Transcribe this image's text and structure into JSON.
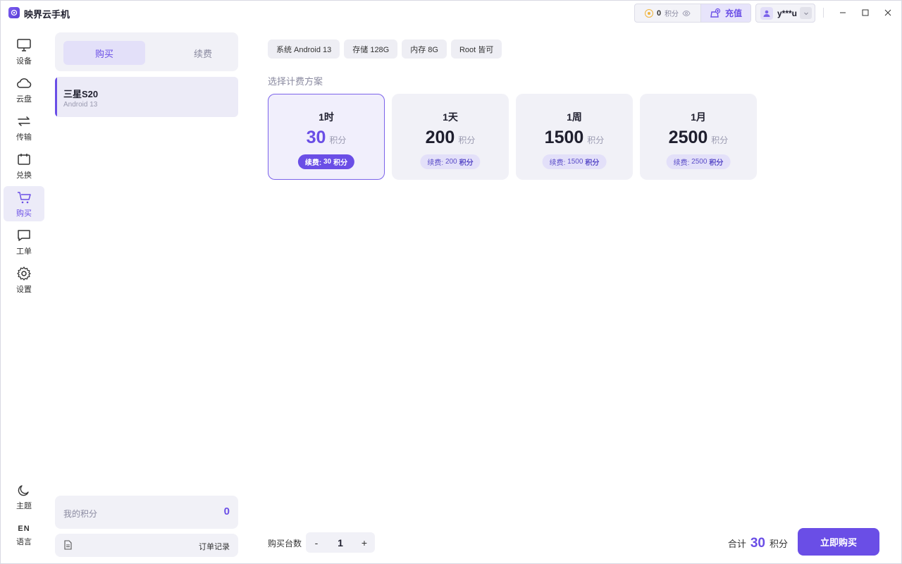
{
  "app": {
    "title": "映界云手机"
  },
  "header": {
    "points_value": "0",
    "points_unit": "积分",
    "recharge_label": "充值",
    "username": "y***u"
  },
  "nav": {
    "items": [
      {
        "label": "设备",
        "icon": "monitor-icon"
      },
      {
        "label": "云盘",
        "icon": "cloud-icon"
      },
      {
        "label": "传输",
        "icon": "transfer-icon"
      },
      {
        "label": "兑换",
        "icon": "ticket-icon"
      },
      {
        "label": "购买",
        "icon": "cart-icon",
        "active": true
      },
      {
        "label": "工单",
        "icon": "chat-icon"
      },
      {
        "label": "设置",
        "icon": "gear-icon"
      }
    ],
    "theme_label": "主题",
    "lang_code": "EN",
    "lang_label": "语言"
  },
  "panel": {
    "tabs": [
      {
        "label": "购买"
      },
      {
        "label": "续费"
      }
    ],
    "device": {
      "name": "三星S20",
      "os": "Android 13"
    },
    "my_points_label": "我的积分",
    "my_points_value": "0",
    "orders_label": "订单记录"
  },
  "main": {
    "specs": [
      "系统 Android 13",
      "存储 128G",
      "内存 8G",
      "Root 皆可"
    ],
    "section_title": "选择计费方案",
    "unit": "积分",
    "renew_prefix": "续费:",
    "plans": [
      {
        "duration": "1时",
        "price": "30",
        "renew": "30",
        "selected": true
      },
      {
        "duration": "1天",
        "price": "200",
        "renew": "200"
      },
      {
        "duration": "1周",
        "price": "1500",
        "renew": "1500"
      },
      {
        "duration": "1月",
        "price": "2500",
        "renew": "2500"
      }
    ],
    "qty_label": "购买台数",
    "qty_minus": "-",
    "qty_value": "1",
    "qty_plus": "+",
    "total_label": "合计",
    "total_value": "30",
    "buy_label": "立即购买"
  },
  "colors": {
    "accent": "#6a4ee6"
  }
}
